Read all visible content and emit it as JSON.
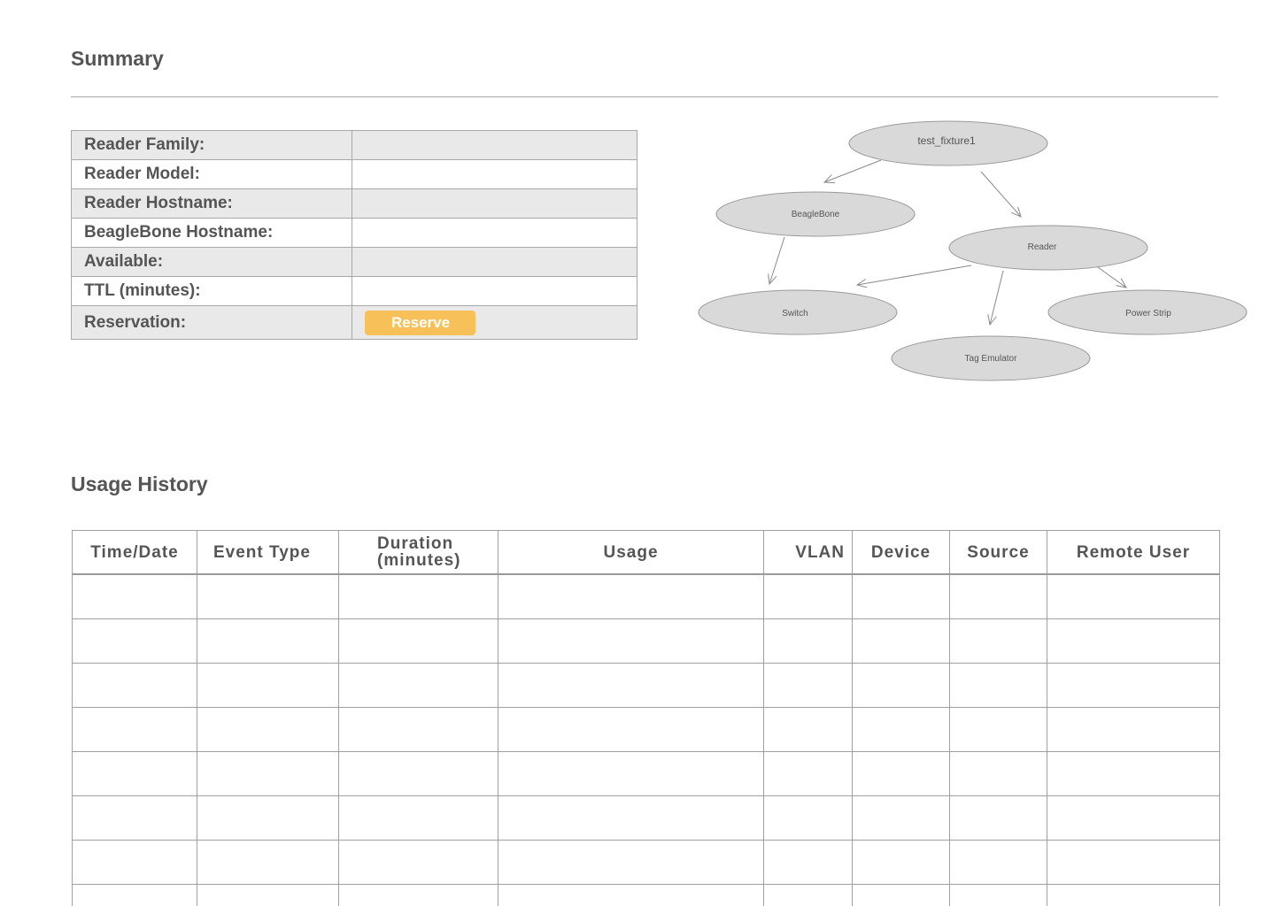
{
  "summary": {
    "title": "Summary",
    "rows": [
      {
        "label": "Reader Family:",
        "value": ""
      },
      {
        "label": "Reader Model:",
        "value": ""
      },
      {
        "label": "Reader Hostname:",
        "value": ""
      },
      {
        "label": "BeagleBone Hostname:",
        "value": ""
      },
      {
        "label": "Available:",
        "value": ""
      },
      {
        "label": "TTL (minutes):",
        "value": ""
      },
      {
        "label": "Reservation:",
        "value": ""
      }
    ],
    "reserve_button_label": "Reserve",
    "reserve_button_color": "#f8c058"
  },
  "diagram": {
    "nodes": {
      "root": "test_fixture1",
      "beaglebone": "BeagleBone",
      "reader": "Reader",
      "switch": "Switch",
      "power_strip": "Power Strip",
      "tag_emulator": "Tag Emulator"
    },
    "node_fill": "#d9d9d9",
    "edges": [
      [
        "root",
        "beaglebone"
      ],
      [
        "root",
        "reader"
      ],
      [
        "beaglebone",
        "switch"
      ],
      [
        "reader",
        "switch"
      ],
      [
        "reader",
        "power_strip"
      ],
      [
        "reader",
        "tag_emulator"
      ]
    ]
  },
  "usage": {
    "title": "Usage History",
    "columns": [
      "Time/Date",
      "Event Type",
      "Duration (minutes)",
      "Usage",
      "VLAN",
      "Device",
      "Source",
      "Remote User"
    ],
    "rows": [
      [
        "",
        "",
        "",
        "",
        "",
        "",
        "",
        ""
      ],
      [
        "",
        "",
        "",
        "",
        "",
        "",
        "",
        ""
      ],
      [
        "",
        "",
        "",
        "",
        "",
        "",
        "",
        ""
      ],
      [
        "",
        "",
        "",
        "",
        "",
        "",
        "",
        ""
      ],
      [
        "",
        "",
        "",
        "",
        "",
        "",
        "",
        ""
      ],
      [
        "",
        "",
        "",
        "",
        "",
        "",
        "",
        ""
      ],
      [
        "",
        "",
        "",
        "",
        "",
        "",
        "",
        ""
      ],
      [
        "",
        "",
        "",
        "",
        "",
        "",
        "",
        ""
      ]
    ]
  }
}
